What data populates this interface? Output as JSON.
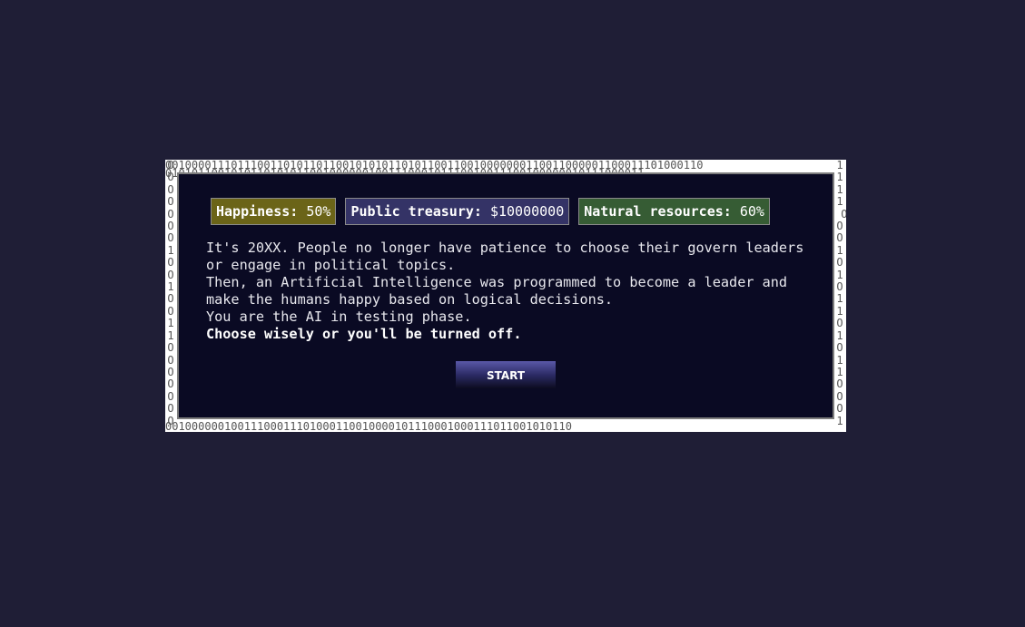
{
  "border": {
    "top": "0010000111011100110101101100101010110101100110010000000110011000001100011101000110",
    "top2": "0101011001010110101011001000000100111000101110010011100100000010111000011",
    "bottom": "00100000010011100011101000110010000101110001000111011001010110",
    "left": "O\nO\nO\nO\nO\nO\nO\n1\nO\nO\n1\nO\nO\n1\n1\nO\nO\nO\nO\nO\nO\nO",
    "right": "1\n1\n1\n1\n O\nO\nO\n1\nO\n1\nO\n1\n1\nO\n1\nO\n1\n1\nO\nO\nO\n1"
  },
  "stats": {
    "happiness": {
      "label": "Happiness:",
      "value": "50%"
    },
    "treasury": {
      "label": "Public treasury:",
      "value": "$10000000"
    },
    "resources": {
      "label": "Natural resources:",
      "value": "60%"
    }
  },
  "story": {
    "line1": "It's 20XX. People no longer have patience to choose their govern leaders or engage in political topics.",
    "line2": "Then, an Artificial Intelligence was programmed to become a leader and make the humans happy based on logical decisions.",
    "line3": "You are the AI in testing phase.",
    "line4": "Choose wisely or you'll be turned off."
  },
  "start_label": "START",
  "colors": {
    "background": "#1f1e36",
    "panel": "#0a0a23",
    "happiness": "#6b6418",
    "treasury": "#343366",
    "resources": "#365c34"
  }
}
